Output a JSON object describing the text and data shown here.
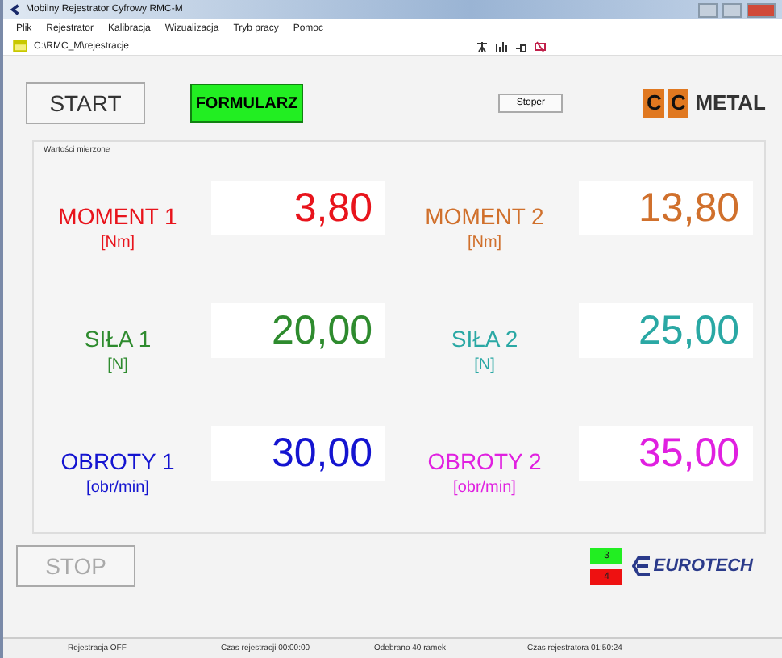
{
  "window": {
    "title": "Mobilny Rejestrator Cyfrowy RMC-M"
  },
  "menu": [
    "Plik",
    "Rejestrator",
    "Kalibracja",
    "Wizualizacja",
    "Tryb pracy",
    "Pomoc"
  ],
  "path": "C:\\RMC_M\\rejestracje",
  "buttons": {
    "start": "START",
    "form": "FORMULARZ",
    "stoper": "Stoper",
    "stop": "STOP"
  },
  "logo": {
    "parts": [
      "C",
      "C",
      "METAL"
    ]
  },
  "group_title": "Wartości mierzone",
  "channels": [
    {
      "name": "MOMENT 1",
      "unit": "[Nm]",
      "value": "3,80",
      "color": "#e8141c"
    },
    {
      "name": "MOMENT 2",
      "unit": "[Nm]",
      "value": "13,80",
      "color": "#d0702c"
    },
    {
      "name": "SIŁA 1",
      "unit": "[N]",
      "value": "20,00",
      "color": "#2e8b2e"
    },
    {
      "name": "SIŁA 2",
      "unit": "[N]",
      "value": "25,00",
      "color": "#2aa8a4"
    },
    {
      "name": "OBROTY 1",
      "unit": "[obr/min]",
      "value": "30,00",
      "color": "#1414d0"
    },
    {
      "name": "OBROTY 2",
      "unit": "[obr/min]",
      "value": "35,00",
      "color": "#e020e0"
    }
  ],
  "indicators": [
    {
      "label": "3",
      "color": "#22ee22"
    },
    {
      "label": "4",
      "color": "#ee1111"
    }
  ],
  "brand": "EUROTECH",
  "status_bar": [
    "Rejestracja OFF",
    "Czas rejestracji 00:00:00",
    "Odebrano 40 ramek",
    "Czas rejestratora 01:50:24"
  ]
}
